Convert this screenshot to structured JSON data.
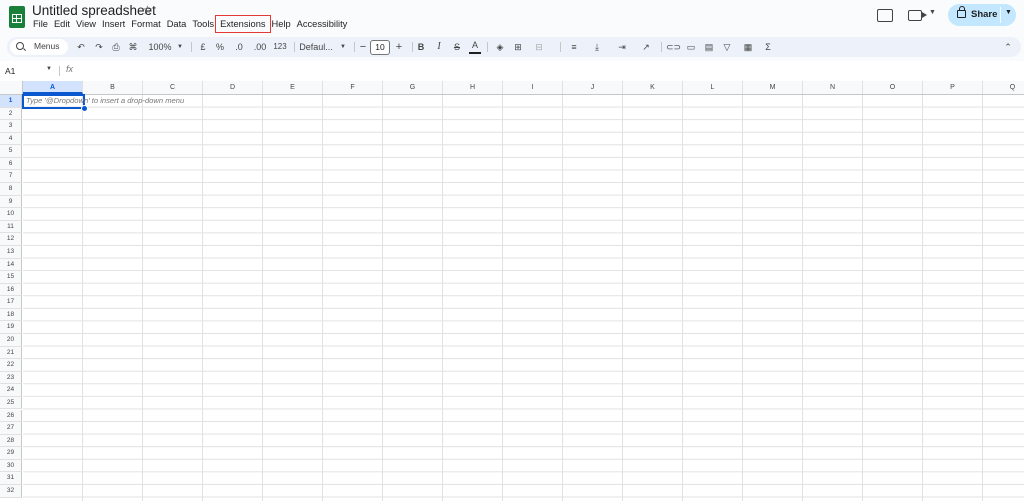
{
  "app": {
    "title": "Untitled spreadsheet"
  },
  "menubar": {
    "items": [
      "File",
      "Edit",
      "View",
      "Insert",
      "Format",
      "Data",
      "Tools",
      "Extensions",
      "Help",
      "Accessibility"
    ],
    "highlighted": "Extensions"
  },
  "header": {
    "share_label": "Share"
  },
  "toolbar": {
    "search_label": "Menus",
    "zoom": "100%",
    "currency": "£",
    "percent": "%",
    "decrease_decimal": ".0",
    "increase_decimal": ".00",
    "number_format": "123",
    "font_family": "Defaul...",
    "font_size": "10",
    "minus": "−",
    "plus": "+",
    "bold": "B",
    "italic": "I",
    "strikethrough": "S",
    "text_color": "A",
    "sum": "Σ"
  },
  "formula_bar": {
    "cell_ref": "A1",
    "fx": "fx"
  },
  "grid": {
    "columns": [
      "A",
      "B",
      "C",
      "D",
      "E",
      "F",
      "G",
      "H",
      "I",
      "J",
      "K",
      "L",
      "M",
      "N",
      "O",
      "P",
      "Q"
    ],
    "rows": [
      "1",
      "2",
      "3",
      "4",
      "5",
      "6",
      "7",
      "8",
      "9",
      "10",
      "11",
      "12",
      "13",
      "14",
      "15",
      "16",
      "17",
      "18",
      "19",
      "20",
      "21",
      "22",
      "23",
      "24",
      "25",
      "26",
      "27",
      "28",
      "29",
      "30",
      "31",
      "32"
    ],
    "selected_cell": "A1",
    "cell_hint": "Type '@Dropdown' to insert a drop-down menu"
  },
  "colors": {
    "accent": "#0b57d0",
    "share_bg": "#c2e7ff",
    "sheets_green": "#188038",
    "highlight_outline": "#e53935"
  }
}
